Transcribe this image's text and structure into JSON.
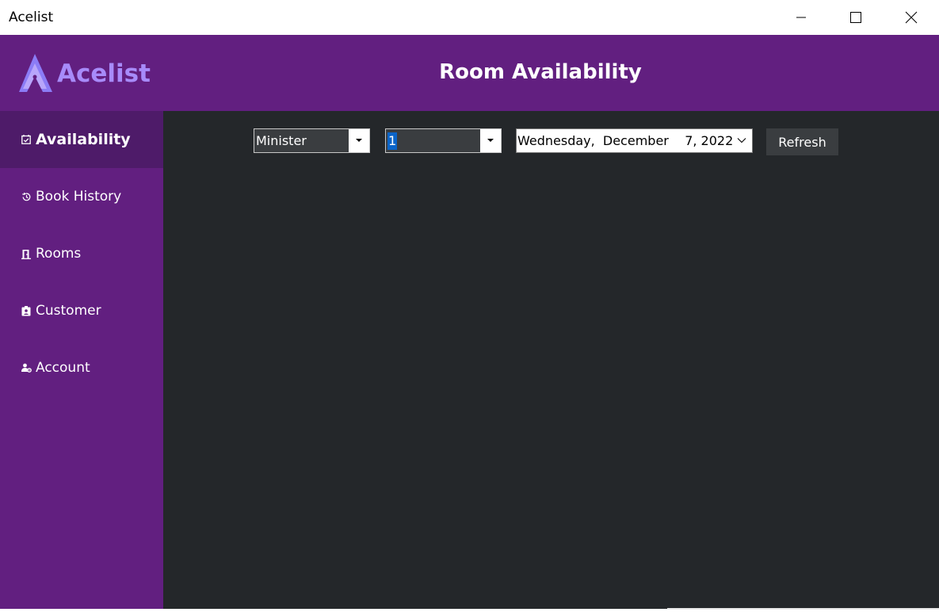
{
  "window": {
    "title": "Acelist"
  },
  "header": {
    "logo_text": "Acelist",
    "page_title": "Room Availability"
  },
  "sidebar": {
    "items": [
      {
        "label": "Availability",
        "icon": "calendar-check-icon",
        "active": true
      },
      {
        "label": "Book History",
        "icon": "history-icon",
        "active": false
      },
      {
        "label": "Rooms",
        "icon": "door-icon",
        "active": false
      },
      {
        "label": "Customer",
        "icon": "id-badge-icon",
        "active": false
      },
      {
        "label": "Account",
        "icon": "user-settings-icon",
        "active": false
      }
    ]
  },
  "filters": {
    "room_type": {
      "value": "Minister"
    },
    "floor": {
      "value": "1"
    },
    "date": {
      "value": "Wednesday,  December    7, 2022"
    },
    "refresh_label": "Refresh"
  },
  "colors": {
    "header_purple": "#621f80",
    "active_nav": "#4e1b69",
    "content_bg": "#24272a",
    "logo": "#a78bfa"
  }
}
